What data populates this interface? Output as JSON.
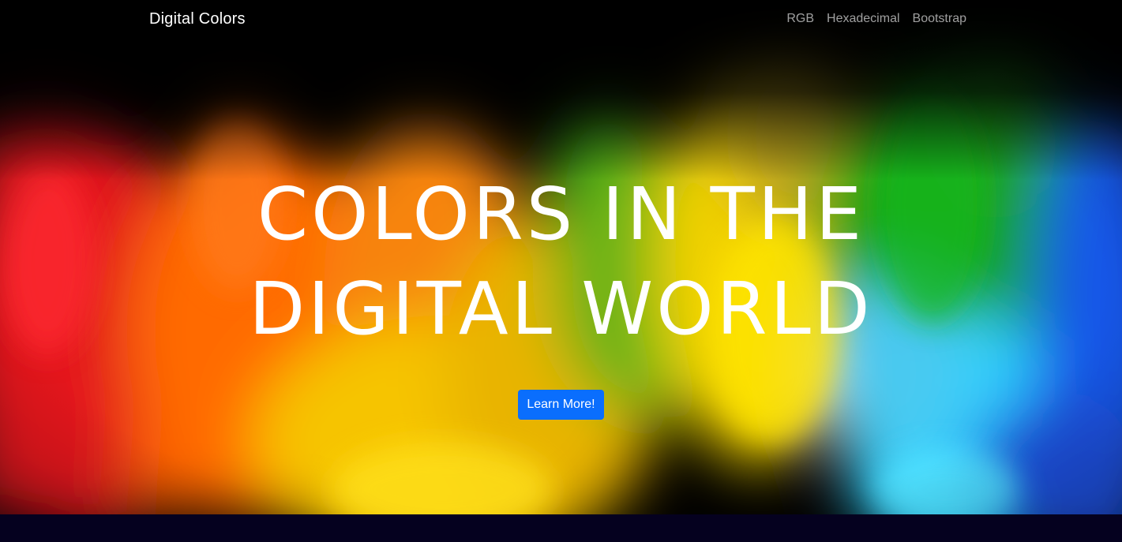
{
  "navbar": {
    "brand": "Digital Colors",
    "links": [
      "RGB",
      "Hexadecimal",
      "Bootstrap"
    ]
  },
  "hero": {
    "headline_line1": "COLORS IN THE",
    "headline_line2": "DIGITAL WORLD",
    "cta_label": "Learn More!",
    "background_image": "colorful-powder-explosion",
    "powder_colors": [
      "#e0161b",
      "#ff6a00",
      "#ffd200",
      "#17a81a",
      "#2fd0ff",
      "#1458e6"
    ]
  },
  "colors": {
    "cta": "#0a6efd",
    "footer_band": "#05011f"
  }
}
